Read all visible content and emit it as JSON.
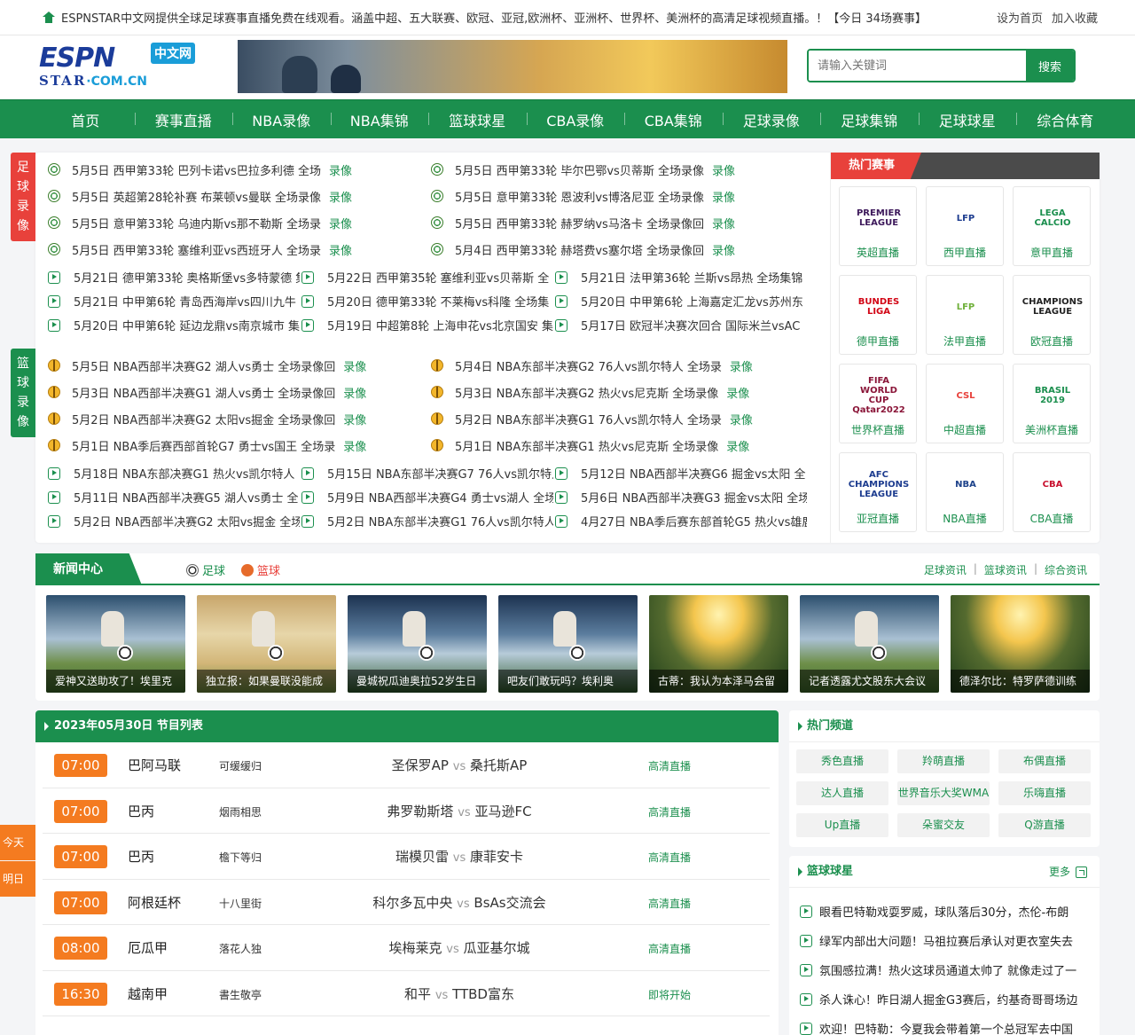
{
  "topbar": {
    "notice": "ESPNSTAR中文网提供全球足球赛事直播免费在线观看。涵盖中超、五大联赛、欧冠、亚冠,欧洲杯、亚洲杯、世界杯、美洲杯的高清足球视频直播。！【今日 34场赛事】",
    "set_home": "设为首页",
    "add_fav": "加入收藏"
  },
  "logo": {
    "brand": "ESPN",
    "cn_badge": "中文网",
    "star": "STAR",
    "domain": "·COM.CN"
  },
  "search": {
    "placeholder": "请输入关键词",
    "button": "搜索"
  },
  "nav": [
    "首页",
    "赛事直播",
    "NBA录像",
    "NBA集锦",
    "篮球球星",
    "CBA录像",
    "CBA集锦",
    "足球录像",
    "足球集锦",
    "足球球星",
    "综合体育"
  ],
  "side_tags": {
    "soccer": [
      "足",
      "球",
      "录",
      "像"
    ],
    "basket": [
      "篮",
      "球",
      "录",
      "像"
    ]
  },
  "soccer_records": [
    {
      "title": "5月5日 西甲第33轮 巴列卡诺vs巴拉多利德 全场",
      "tag": "录像"
    },
    {
      "title": "5月5日 西甲第33轮 毕尔巴鄂vs贝蒂斯 全场录像",
      "tag": "录像"
    },
    {
      "title": "5月5日 英超第28轮补赛 布莱顿vs曼联 全场录像",
      "tag": "录像"
    },
    {
      "title": "5月5日 意甲第33轮 恩波利vs博洛尼亚 全场录像",
      "tag": "录像"
    },
    {
      "title": "5月5日 意甲第33轮 乌迪内斯vs那不勒斯 全场录",
      "tag": "录像"
    },
    {
      "title": "5月5日 西甲第33轮 赫罗纳vs马洛卡 全场录像回",
      "tag": "录像"
    },
    {
      "title": "5月5日 西甲第33轮 塞维利亚vs西班牙人 全场录",
      "tag": "录像"
    },
    {
      "title": "5月4日 西甲第33轮 赫塔费vs塞尔塔 全场录像回",
      "tag": "录像"
    }
  ],
  "soccer_plays": [
    "5月21日 德甲第33轮 奥格斯堡vs多特蒙德 集",
    "5月22日 西甲第35轮 塞维利亚vs贝蒂斯 全",
    "5月21日 法甲第36轮 兰斯vs昂热 全场集锦",
    "5月21日 中甲第6轮 青岛西海岸vs四川九牛",
    "5月20日 德甲第33轮 不莱梅vs科隆 全场集",
    "5月20日 中甲第6轮 上海嘉定汇龙vs苏州东",
    "5月20日 中甲第6轮 延边龙鼎vs南京城市 集",
    "5月19日 中超第8轮 上海申花vs北京国安 集",
    "5月17日 欧冠半决赛次回合 国际米兰vsAC"
  ],
  "basket_records": [
    {
      "title": "5月5日 NBA西部半决赛G2 湖人vs勇士 全场录像回",
      "tag": "录像"
    },
    {
      "title": "5月4日 NBA东部半决赛G2 76人vs凯尔特人 全场录",
      "tag": "录像"
    },
    {
      "title": "5月3日 NBA西部半决赛G1 湖人vs勇士 全场录像回",
      "tag": "录像"
    },
    {
      "title": "5月3日 NBA东部半决赛G2 热火vs尼克斯 全场录像",
      "tag": "录像"
    },
    {
      "title": "5月2日 NBA西部半决赛G2 太阳vs掘金 全场录像回",
      "tag": "录像"
    },
    {
      "title": "5月2日 NBA东部半决赛G1 76人vs凯尔特人 全场录",
      "tag": "录像"
    },
    {
      "title": "5月1日 NBA季后赛西部首轮G7 勇士vs国王 全场录",
      "tag": "录像"
    },
    {
      "title": "5月1日 NBA东部半决赛G1 热火vs尼克斯 全场录像",
      "tag": "录像"
    }
  ],
  "basket_plays": [
    "5月18日 NBA东部决赛G1 热火vs凯尔特人",
    "5月15日 NBA东部半决赛G7 76人vs凯尔特人",
    "5月12日 NBA西部半决赛G6 掘金vs太阳 全",
    "5月11日 NBA西部半决赛G5 湖人vs勇士 全",
    "5月9日 NBA西部半决赛G4 勇士vs湖人 全场",
    "5月6日 NBA西部半决赛G3 掘金vs太阳 全场",
    "5月2日 NBA西部半决赛G2 太阳vs掘金 全场",
    "5月2日 NBA东部半决赛G1 76人vs凯尔特人",
    "4月27日 NBA季后赛东部首轮G5 热火vs雄鹿"
  ],
  "hot": {
    "title": "热门赛事",
    "leagues": [
      {
        "logo": "PREMIER LEAGUE",
        "name": "英超直播",
        "color": "#3d195b"
      },
      {
        "logo": "LFP",
        "name": "西甲直播",
        "color": "#1d3c8f"
      },
      {
        "logo": "LEGA CALCIO",
        "name": "意甲直播",
        "color": "#1b8f4e"
      },
      {
        "logo": "BUNDES LIGA",
        "name": "德甲直播",
        "color": "#d20515"
      },
      {
        "logo": "LFP",
        "name": "法甲直播",
        "color": "#6fb03a"
      },
      {
        "logo": "CHAMPIONS LEAGUE",
        "name": "欧冠直播",
        "color": "#222222"
      },
      {
        "logo": "FIFA WORLD CUP Qatar2022",
        "name": "世界杯直播",
        "color": "#8a1538"
      },
      {
        "logo": "CSL",
        "name": "中超直播",
        "color": "#e8413b"
      },
      {
        "logo": "BRASIL 2019",
        "name": "美洲杯直播",
        "color": "#1b8f4e"
      },
      {
        "logo": "AFC CHAMPIONS LEAGUE",
        "name": "亚冠直播",
        "color": "#1d3c8f"
      },
      {
        "logo": "NBA",
        "name": "NBA直播",
        "color": "#1d428a"
      },
      {
        "logo": "CBA",
        "name": "CBA直播",
        "color": "#c8102e"
      }
    ]
  },
  "news": {
    "tab": "新闻中心",
    "subtabs": [
      "足球",
      "篮球"
    ],
    "right_links": [
      "足球资讯",
      "篮球资讯",
      "综合资讯"
    ],
    "cards": [
      "爱神又送助攻了！埃里克",
      "独立报：如果曼联没能成",
      "曼城祝瓜迪奥拉52岁生日",
      "吧友们敢玩吗？埃利奥",
      "古蒂：我认为本泽马会留",
      "记者透露尤文股东大会议",
      "德泽尔比：特罗萨德训练"
    ]
  },
  "schedule": {
    "title": "2023年05月30日 节目列表",
    "vs": "vs",
    "rows": [
      {
        "time": "07:00",
        "league": "巴阿马联",
        "anchor": "可缓缓归",
        "home": "圣保罗AP",
        "away": "桑托斯AP",
        "status": "高清直播"
      },
      {
        "time": "07:00",
        "league": "巴丙",
        "anchor": "烟雨相思",
        "home": "弗罗勒斯塔",
        "away": "亚马逊FC",
        "status": "高清直播"
      },
      {
        "time": "07:00",
        "league": "巴丙",
        "anchor": "檐下等归",
        "home": "瑞模贝雷",
        "away": "康菲安卡",
        "status": "高清直播"
      },
      {
        "time": "07:00",
        "league": "阿根廷杯",
        "anchor": "十八里街",
        "home": "科尔多瓦中央",
        "away": "BsAs交流会",
        "status": "高清直播"
      },
      {
        "time": "08:00",
        "league": "厄瓜甲",
        "anchor": "落花人独",
        "home": "埃梅莱克",
        "away": "瓜亚基尔城",
        "status": "高清直播"
      },
      {
        "time": "16:30",
        "league": "越南甲",
        "anchor": "書生敬亭",
        "home": "和平",
        "away": "TTBD富东",
        "status": "即将开始"
      }
    ]
  },
  "day_tabs": [
    "今天",
    "明日"
  ],
  "channels": {
    "title": "热门频道",
    "items": [
      "秀色直播",
      "羚萌直播",
      "布偶直播",
      "达人直播",
      "世界音乐大奖WMA",
      "乐嗨直播",
      "Up直播",
      "朵蜜交友",
      "Q游直播"
    ]
  },
  "stars": {
    "title": "篮球球星",
    "more": "更多",
    "items": [
      "眼看巴特勒戏耍罗威，球队落后30分，杰伦-布朗",
      "绿军内部出大问题！马祖拉赛后承认对更衣室失去",
      "氛围感拉满！热火这球员通道太帅了 就像走过了一",
      "杀人诛心！昨日湖人掘金G3赛后，约基奇哥哥场边",
      "欢迎！巴特勒：今夏我会带着第一个总冠军去中国"
    ]
  },
  "colors": {
    "brand_green": "#1b8f4e",
    "accent_red": "#e8413b",
    "time_orange": "#f47b20"
  }
}
